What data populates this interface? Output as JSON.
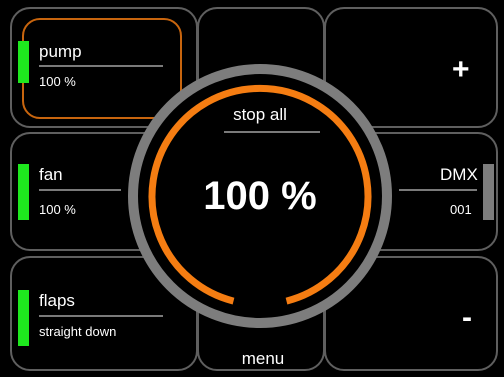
{
  "channels": {
    "pump": {
      "name": "pump",
      "value": "100 %"
    },
    "fan": {
      "name": "fan",
      "value": "100 %"
    },
    "flaps": {
      "name": "flaps",
      "value": "straight down"
    },
    "dmx": {
      "name": "DMX",
      "value": "001"
    }
  },
  "controls": {
    "increase_label": "+",
    "decrease_label": "-",
    "stop_all_label": "stop all",
    "menu_label": "menu"
  },
  "master": {
    "value_label": "100 %"
  },
  "colors": {
    "active_indicator": "#1ee81e",
    "inactive_indicator": "#7d7d7d",
    "accent": "#f57d12",
    "selection": "#c8650e",
    "tile_border": "#5f5f5f"
  }
}
